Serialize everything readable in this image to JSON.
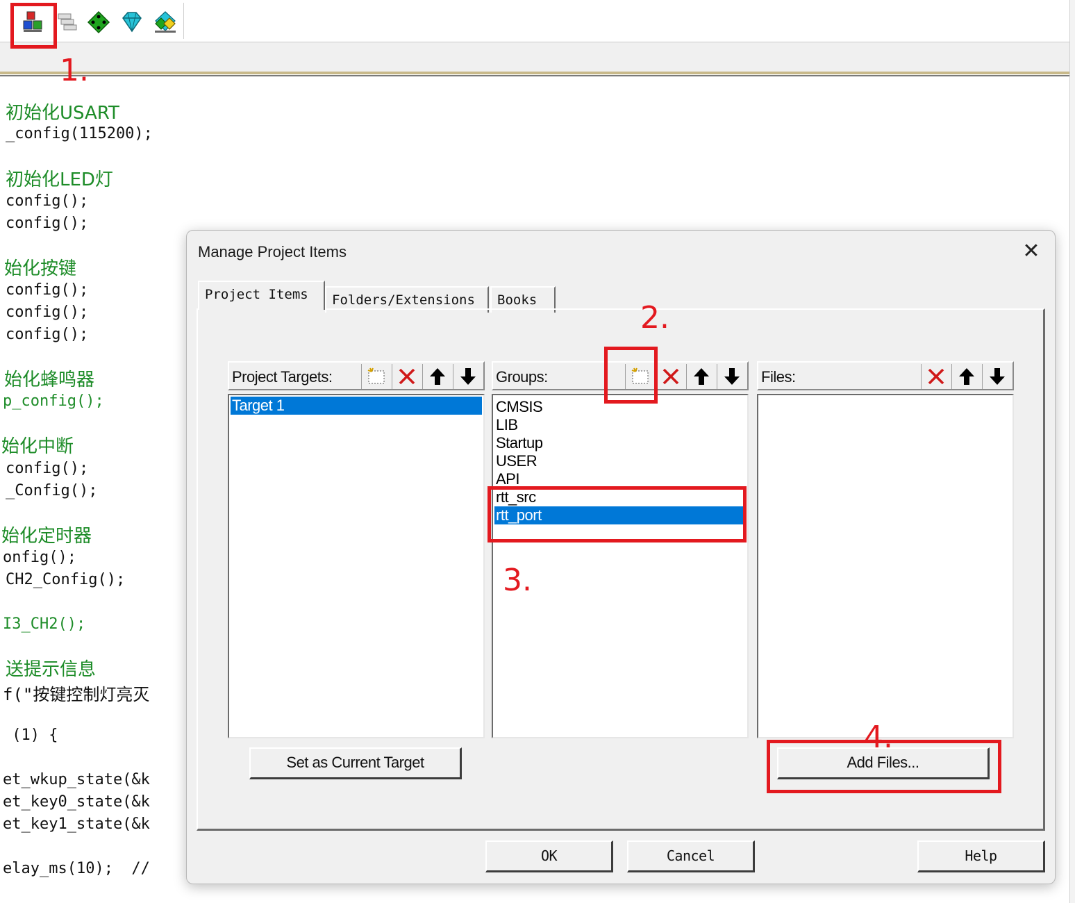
{
  "toolbar": {
    "icons": [
      "manage-project-items-icon",
      "batch-build-icon",
      "select-packs-icon",
      "manage-rte-icon",
      "pack-installer-icon"
    ]
  },
  "code_lines": [
    {
      "text": "初始化USART",
      "kind": "comment"
    },
    {
      "text": "_config(115200);",
      "kind": "code"
    },
    {
      "text": "初始化LED灯",
      "kind": "comment"
    },
    {
      "text": "config();",
      "kind": "code"
    },
    {
      "text": "config();",
      "kind": "code"
    },
    {
      "text": "始化按键",
      "kind": "comment"
    },
    {
      "text": "config();",
      "kind": "code"
    },
    {
      "text": "config();",
      "kind": "code"
    },
    {
      "text": "config();",
      "kind": "code"
    },
    {
      "text": "始化蜂鸣器",
      "kind": "comment"
    },
    {
      "text": "p_config();",
      "kind": "code"
    },
    {
      "text": "始化中断",
      "kind": "comment"
    },
    {
      "text": "config();",
      "kind": "code"
    },
    {
      "text": "_Config();",
      "kind": "code"
    },
    {
      "text": "始化定时器",
      "kind": "comment"
    },
    {
      "text": "onfig();",
      "kind": "code"
    },
    {
      "text": "CH2_Config();",
      "kind": "code"
    },
    {
      "text": "I3_CH2();",
      "kind": "code"
    },
    {
      "text": "送提示信息",
      "kind": "comment"
    },
    {
      "text": "f(\"按键控制灯亮灭",
      "kind": "code"
    },
    {
      "text": " (1) {",
      "kind": "code"
    },
    {
      "text": "et_wkup_state(&k",
      "kind": "code"
    },
    {
      "text": "et_key0_state(&k",
      "kind": "code"
    },
    {
      "text": "et_key1_state(&k",
      "kind": "code"
    },
    {
      "text": "elay_ms(10);  //",
      "kind": "code"
    }
  ],
  "annotations": [
    "1.",
    "2.",
    "3.",
    "4."
  ],
  "dialog": {
    "title": "Manage Project Items",
    "close": "✕",
    "tabs": [
      "Project Items",
      "Folders/Extensions",
      "Books"
    ],
    "active_tab": "Project Items",
    "targets": {
      "label": "Project Targets:",
      "items": [
        {
          "label": "Target 1",
          "selected": true
        }
      ]
    },
    "groups": {
      "label": "Groups:",
      "items": [
        {
          "label": "CMSIS",
          "selected": false
        },
        {
          "label": "LIB",
          "selected": false
        },
        {
          "label": "Startup",
          "selected": false
        },
        {
          "label": "USER",
          "selected": false
        },
        {
          "label": "API",
          "selected": false
        },
        {
          "label": "rtt_src",
          "selected": false
        },
        {
          "label": "rtt_port",
          "selected": true
        }
      ]
    },
    "files": {
      "label": "Files:",
      "items": []
    },
    "buttons": {
      "set_current_target": "Set as Current Target",
      "add_files": "Add Files...",
      "ok": "OK",
      "cancel": "Cancel",
      "help": "Help"
    }
  },
  "colors": {
    "annotation_red": "#e3191f",
    "selection_blue": "#0078d7",
    "comment_green": "#1d8c28"
  }
}
